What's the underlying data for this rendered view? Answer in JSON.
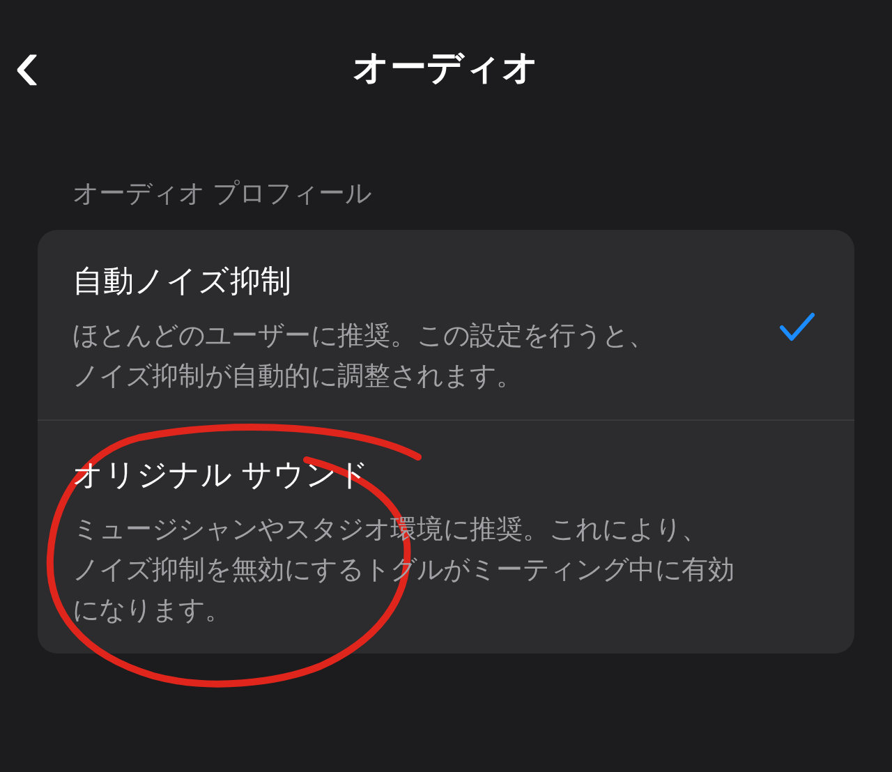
{
  "header": {
    "back": "‹",
    "title": "オーディオ"
  },
  "section_label": "オーディオ プロフィール",
  "options": [
    {
      "title": "自動ノイズ抑制",
      "description_lines": [
        "ほとんどのユーザーに推奨。この設定を行うと、",
        "ノイズ抑制が自動的に調整されます。"
      ],
      "selected": true
    },
    {
      "title": "オリジナル サウンド",
      "description_lines": [
        "ミュージシャンやスタジオ環境に推奨。これにより、",
        "ノイズ抑制を無効にするトグルがミーティング中に有効",
        "になります。"
      ],
      "selected": false
    }
  ]
}
